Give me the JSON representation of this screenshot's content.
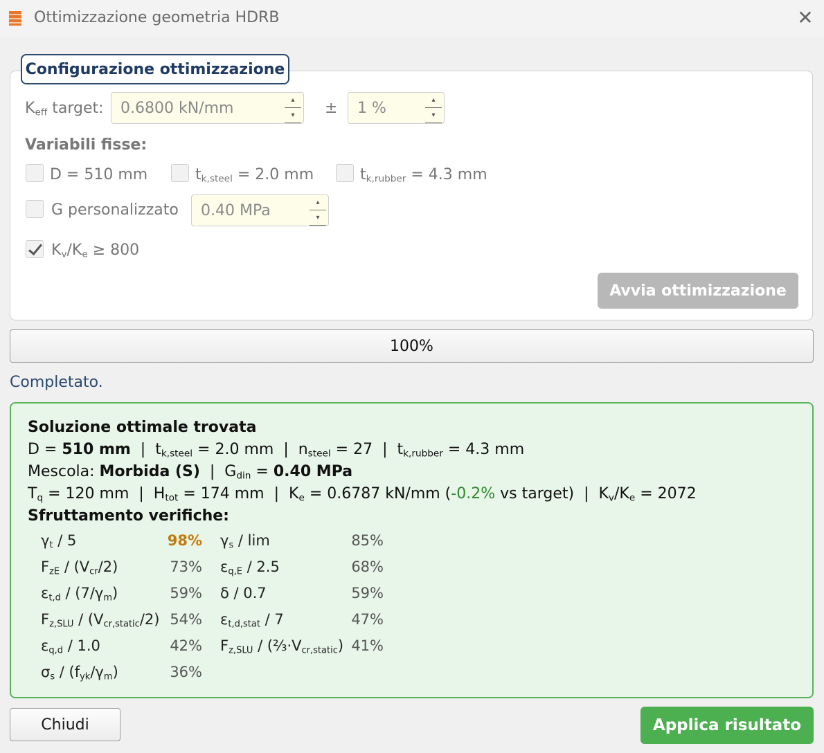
{
  "window": {
    "title": "Ottimizzazione geometria HDRB",
    "close_glyph": "✕",
    "icon": "app-icon"
  },
  "config": {
    "group_title": "Configurazione ottimizzazione",
    "keff_label": "K",
    "keff_label_sub": "eff",
    "keff_label_suffix": " target:",
    "keff_value": "0.6800 kN/mm",
    "pm_label": "±",
    "tolerance_value": "1 %",
    "fixed_vars_label": "Variabili fisse:",
    "fixed": [
      {
        "prefix": "D = 510 mm",
        "sub": "",
        "suffix": "",
        "checked": false
      },
      {
        "prefix": "t",
        "sub": "k,steel",
        "suffix": " = 2.0 mm",
        "checked": false
      },
      {
        "prefix": "t",
        "sub": "k,rubber",
        "suffix": " = 4.3 mm",
        "checked": false
      }
    ],
    "g_custom_label": "G personalizzato",
    "g_custom_checked": false,
    "g_value": "0.40 MPa",
    "kvke": {
      "k1": "K",
      "s1": "v",
      "mid": "/K",
      "s2": "e",
      "suffix": " ≥ 800",
      "checked": true
    },
    "start_button": "Avvia ottimizzazione"
  },
  "progress": {
    "value": 100,
    "label": "100%"
  },
  "status": "Completato.",
  "result": {
    "heading": "Soluzione ottimale trovata",
    "line1": {
      "d_label": "D = ",
      "d_value": "510 mm",
      "sep": "  |  ",
      "tsteel_t": "t",
      "tsteel_sub": "k,steel",
      "tsteel_val": " = 2.0 mm",
      "n_t": "n",
      "n_sub": "steel",
      "n_val": " = 27",
      "trub_t": "t",
      "trub_sub": "k,rubber",
      "trub_val": " = 4.3 mm"
    },
    "line2": {
      "mix_label": "Mescola: ",
      "mix_value": "Morbida (S)",
      "sep": "  |  ",
      "g_t": "G",
      "g_sub": "din",
      "g_eq": " = ",
      "g_value": "0.40 MPa"
    },
    "line3": {
      "tq_t": "T",
      "tq_sub": "q",
      "tq_val": " = 120 mm",
      "h_t": "H",
      "h_sub": "tot",
      "h_val": " = 174 mm",
      "ke_t": "K",
      "ke_sub": "e",
      "ke_val": " = 0.6787 kN/mm (",
      "delta": "-0.2%",
      "delta_suffix": " vs target)",
      "kv_t": "K",
      "kv_sub": "v",
      "kv_mid": "/K",
      "kv_sub2": "e",
      "kv_val": " = 2072"
    },
    "checks_heading": "Sfruttamento verifiche:",
    "checks_left": [
      {
        "label_html": "γ<sub>t</sub> / 5",
        "value": "98%",
        "hot": true
      },
      {
        "label_html": "F<sub>zE</sub> / (V<sub>cr</sub>/2)",
        "value": "73%",
        "hot": false
      },
      {
        "label_html": "ε<sub>t,d</sub> / (7/γ<sub>m</sub>)",
        "value": "59%",
        "hot": false
      },
      {
        "label_html": "F<sub>z,SLU</sub> / (V<sub>cr,static</sub>/2)",
        "value": "54%",
        "hot": false
      },
      {
        "label_html": "ε<sub>q,d</sub> / 1.0",
        "value": "42%",
        "hot": false
      },
      {
        "label_html": "σ<sub>s</sub> / (f<sub>yk</sub>/γ<sub>m</sub>)",
        "value": "36%",
        "hot": false
      }
    ],
    "checks_right": [
      {
        "label_html": "γ<sub>s</sub> / lim",
        "value": "85%"
      },
      {
        "label_html": "ε<sub>q,E</sub> / 2.5",
        "value": "68%"
      },
      {
        "label_html": "δ / 0.7",
        "value": "59%"
      },
      {
        "label_html": "ε<sub>t,d,stat</sub> / 7",
        "value": "47%"
      },
      {
        "label_html": "F<sub>z,SLU</sub> / (⅔·V<sub>cr,static</sub>)",
        "value": "41%"
      }
    ]
  },
  "buttons": {
    "close": "Chiudi",
    "apply": "Applica risultato"
  },
  "colors": {
    "accent_blue": "#2b4a6e",
    "success_green": "#4caf50",
    "hot_orange": "#c27c0e"
  }
}
